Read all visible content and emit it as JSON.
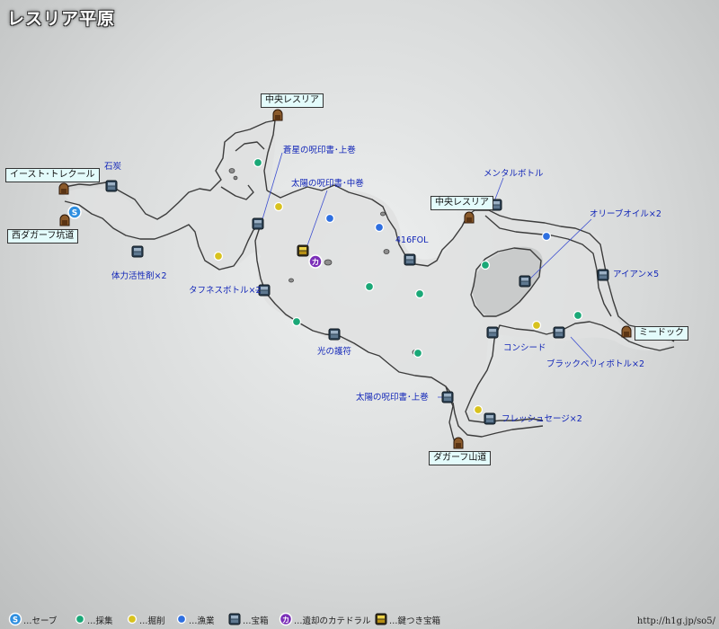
{
  "title": "レスリア平原",
  "url": "http://h1g.jp/so5/",
  "locations": {
    "east_torecool": "イースト･トレクール",
    "west_dagarf_mine": "西ダガーフ坑道",
    "central_resria_north": "中央レスリア",
    "central_resria_east": "中央レスリア",
    "meedock": "ミードック",
    "dagarf_mountain": "ダガーフ山道"
  },
  "labels": {
    "coal": "石炭",
    "vitality_potion": "体力活性剤×2",
    "tafness_bottle": "タフネスボトル×2",
    "blue_star_upper": "蒼星の呪印書･上巻",
    "sun_middle": "太陽の呪印書･中巻",
    "light_amulet": "光の護符",
    "fol416": "416FOL",
    "mental_bottle": "メンタルボトル",
    "olive_oil": "オリーブオイル×2",
    "iron": "アイアン×5",
    "consider": "コンシード",
    "blackberry_bottle": "ブラックベリィボトル×2",
    "sun_upper": "太陽の呪印書･上巻",
    "fresh_sage": "フレッシュセージ×2"
  },
  "legend": {
    "save": "…セーブ",
    "gather": "…採集",
    "mining": "…掘削",
    "fishing": "…漁業",
    "chest": "…宝箱",
    "forgotten_cathedral": "…遺却のカテドラル",
    "locked_chest": "…鍵つき宝箱"
  },
  "icons": {
    "save": "S",
    "cathedral": "カ"
  },
  "colors": {
    "gather": "#1aa877",
    "mining": "#d8c21e",
    "fishing": "#2e6fe0",
    "chest": "#3a5266",
    "locked_chest": "#c9a417",
    "cathedral": "#7b2fb8",
    "save": "#2f8fe0",
    "label": "#1226b8",
    "box": "#e3fbfb"
  }
}
